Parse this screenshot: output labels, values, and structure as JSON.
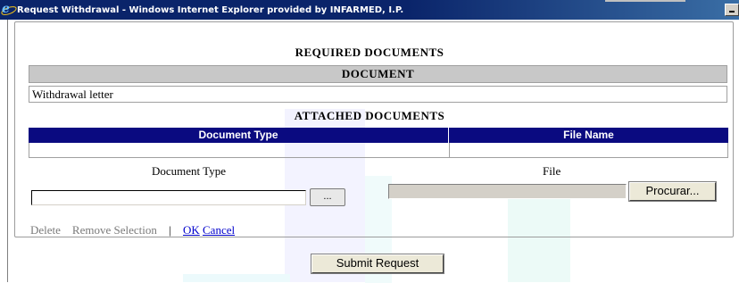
{
  "window": {
    "title": "Request Withdrawal - Windows Internet Explorer provided by INFARMED, I.P."
  },
  "required": {
    "heading": "REQUIRED DOCUMENTS",
    "column_header": "DOCUMENT",
    "rows": [
      "Withdrawal letter"
    ]
  },
  "attached": {
    "heading": "ATTACHED DOCUMENTS",
    "columns": [
      "Document Type",
      "File Name"
    ],
    "rows": []
  },
  "form": {
    "document_type_label": "Document Type",
    "document_type_value": "",
    "browse_small_label": "...",
    "file_label": "File",
    "file_value": "",
    "procurar_label": "Procurar..."
  },
  "actions": {
    "delete": "Delete",
    "remove_selection": "Remove Selection",
    "separator": "|",
    "ok": "OK",
    "cancel": "Cancel"
  },
  "submit_label": "Submit Request",
  "colors": {
    "title_bar": "#0a246a",
    "table_header": "#0a0a80",
    "section_header_bg": "#c8c8c8",
    "link": "#0000cc"
  }
}
